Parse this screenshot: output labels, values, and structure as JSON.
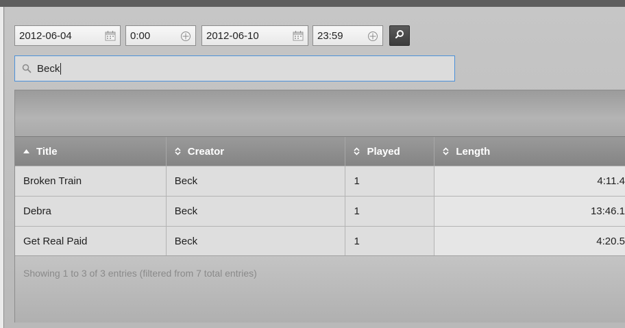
{
  "filters": {
    "start_date": "2012-06-04",
    "start_time": "0:00",
    "end_date": "2012-06-10",
    "end_time": "23:59",
    "search_value": "Beck"
  },
  "table": {
    "columns": [
      "Title",
      "Creator",
      "Played",
      "Length"
    ],
    "rows": [
      {
        "title": "Broken Train",
        "creator": "Beck",
        "played": "1",
        "length": "4:11.4"
      },
      {
        "title": "Debra",
        "creator": "Beck",
        "played": "1",
        "length": "13:46.1"
      },
      {
        "title": "Get Real Paid",
        "creator": "Beck",
        "played": "1",
        "length": "4:20.5"
      }
    ],
    "info": "Showing 1 to 3 of 3 entries (filtered from 7 total entries)"
  },
  "icons": {
    "calendar": "calendar-icon",
    "clock": "clock-icon",
    "search": "magnifier-icon",
    "sort_asc": "sort-ascending-icon",
    "sort_both": "sort-both-icon"
  },
  "colors": {
    "focus_border": "#4a90d9",
    "header_bg": "#8c8c8c"
  }
}
